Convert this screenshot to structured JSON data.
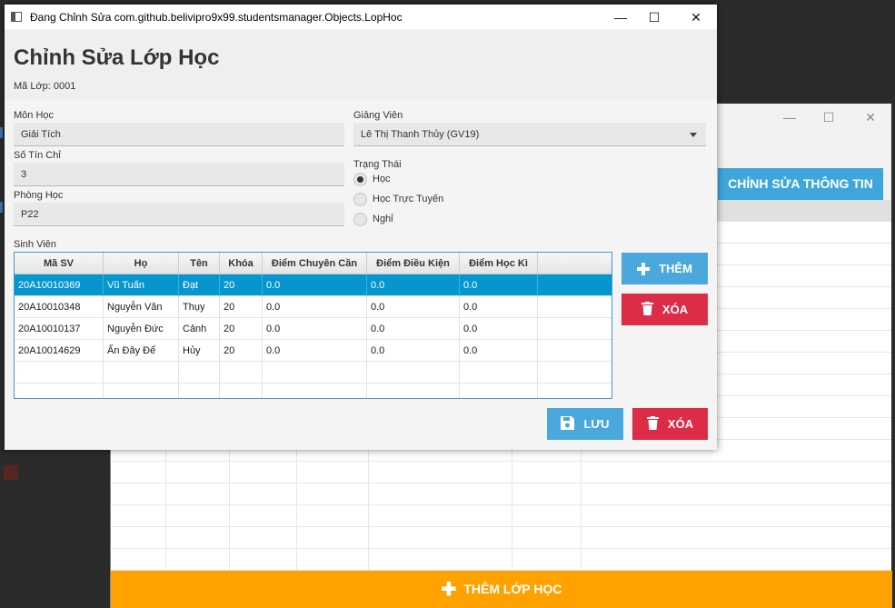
{
  "background_window": {
    "edit_info_label": "CHỈNH SỬA THÔNG TIN",
    "add_class_label": "THÊM LỚP HỌC",
    "minimize_glyph": "—",
    "maximize_glyph": "☐",
    "close_glyph": "✕"
  },
  "dialog": {
    "window_title": "Đang Chỉnh Sửa com.github.belivipro9x99.studentsmanager.Objects.LopHoc",
    "minimize_glyph": "—",
    "maximize_glyph": "☐",
    "close_glyph": "✕",
    "page_title": "Chỉnh Sửa Lớp Học",
    "class_code": "Mã Lớp: 0001"
  },
  "form": {
    "subject_label": "Môn Học",
    "subject_value": "Giải Tích",
    "credits_label": "Số Tín Chỉ",
    "credits_value": "3",
    "room_label": "Phòng Học",
    "room_value": "P22",
    "lecturer_label": "Giảng Viên",
    "lecturer_value": "Lê Thị Thanh Thủy (GV19)",
    "status_label": "Trạng Thái",
    "status_options": [
      {
        "label": "Học",
        "selected": true
      },
      {
        "label": "Học Trực Tuyến",
        "selected": false
      },
      {
        "label": "Nghỉ",
        "selected": false
      }
    ],
    "students_label": "Sinh Viên"
  },
  "students_table": {
    "columns": [
      "Mã SV",
      "Họ",
      "Tên",
      "Khóa",
      "Điểm Chuyên Cần",
      "Điểm Điều Kiện",
      "Điểm Học Kì"
    ],
    "rows": [
      [
        "20A10010369",
        "Vũ Tuấn",
        "Đạt",
        "20",
        "0.0",
        "0.0",
        "0.0"
      ],
      [
        "20A10010348",
        "Nguyễn Văn",
        "Thụy",
        "20",
        "0.0",
        "0.0",
        "0.0"
      ],
      [
        "20A10010137",
        "Nguyễn Đức",
        "Cảnh",
        "20",
        "0.0",
        "0.0",
        "0.0"
      ],
      [
        "20A10014629",
        "Ấn Đây Để",
        "Hủy",
        "20",
        "0.0",
        "0.0",
        "0.0"
      ]
    ],
    "selected_row": 0
  },
  "buttons": {
    "add_student": "THÊM",
    "delete_student": "XÓA",
    "save": "LƯU",
    "delete_class": "XÓA"
  },
  "icons": {
    "plus": "plus-icon",
    "trash": "trash-icon",
    "save": "floppy-disk-icon"
  },
  "colors": {
    "accent_blue": "#4aa8dc",
    "danger_red": "#dd2c48",
    "selection_blue": "#0596cf",
    "warning_orange": "#ffa200"
  }
}
